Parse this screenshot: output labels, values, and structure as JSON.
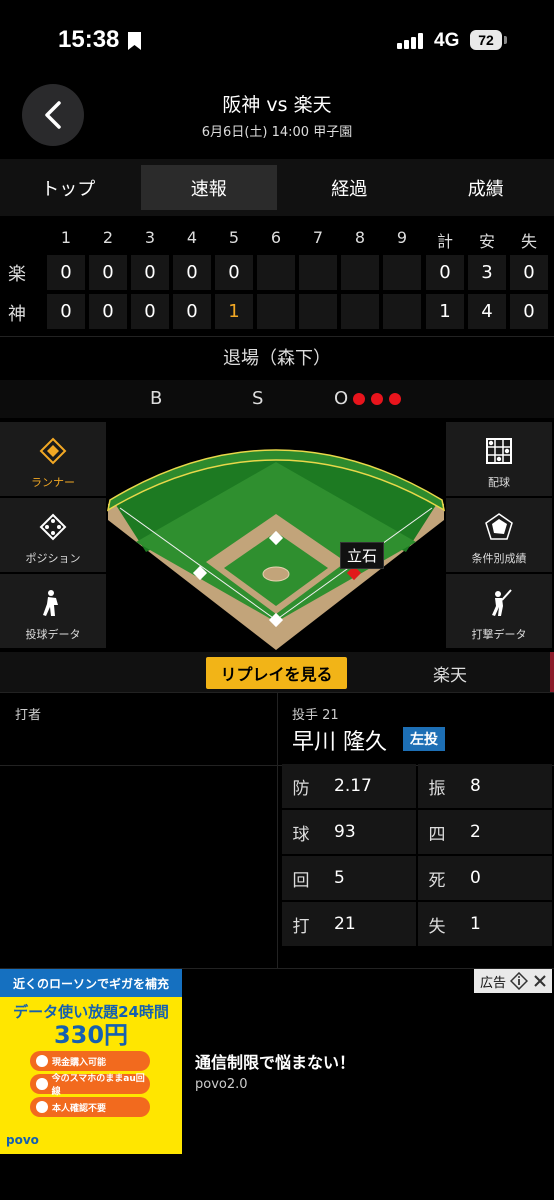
{
  "status_bar": {
    "time": "15:38",
    "network": "4G",
    "battery": "72"
  },
  "header": {
    "title": "阪神 vs 楽天",
    "subtitle": "6月6日(土) 14:00 甲子園",
    "back_icon": "chevron-left-icon"
  },
  "tabs": [
    {
      "label": "トップ",
      "active": false
    },
    {
      "label": "速報",
      "active": true
    },
    {
      "label": "経過",
      "active": false
    },
    {
      "label": "成績",
      "active": false
    }
  ],
  "scoreboard": {
    "headers": [
      "1",
      "2",
      "3",
      "4",
      "5",
      "6",
      "7",
      "8",
      "9",
      "計",
      "安",
      "失"
    ],
    "rows": [
      {
        "team": "楽",
        "innings": [
          "0",
          "0",
          "0",
          "0",
          "0",
          "",
          "",
          "",
          ""
        ],
        "totals": [
          "0",
          "3",
          "0"
        ]
      },
      {
        "team": "神",
        "innings": [
          "0",
          "0",
          "0",
          "0",
          "1",
          "",
          "",
          "",
          ""
        ],
        "totals": [
          "1",
          "4",
          "0"
        ]
      }
    ],
    "highlight_color": "#f2a824"
  },
  "event": "退場（森下）",
  "count": {
    "ball_label": "B",
    "strike_label": "S",
    "out_label": "O",
    "outs": 3,
    "out_color": "#e8141c"
  },
  "left_buttons": [
    {
      "label": "ランナー",
      "icon": "diamond-icon",
      "active": true
    },
    {
      "label": "ポジション",
      "icon": "position-icon",
      "active": false
    },
    {
      "label": "投球データ",
      "icon": "pitcher-icon",
      "active": false
    }
  ],
  "right_buttons": [
    {
      "label": "配球",
      "icon": "grid-icon"
    },
    {
      "label": "条件別成績",
      "icon": "radar-icon"
    },
    {
      "label": "打撃データ",
      "icon": "batter-icon"
    }
  ],
  "field": {
    "runner_label": "立石"
  },
  "replay": {
    "button": "リプレイを見る",
    "team": "楽天"
  },
  "batter": {
    "label": "打者"
  },
  "pitcher": {
    "label": "投手 21",
    "name": "早川 隆久",
    "hand": "左投",
    "stats": [
      {
        "k": "防",
        "v": "2.17",
        "k2": "振",
        "v2": "8"
      },
      {
        "k": "球",
        "v": "93",
        "k2": "四",
        "v2": "2"
      },
      {
        "k": "回",
        "v": "5",
        "k2": "死",
        "v2": "0"
      },
      {
        "k": "打",
        "v": "21",
        "k2": "失",
        "v2": "1"
      }
    ]
  },
  "ad": {
    "image_top": "近くのローソンでギガを補充",
    "image_line1": "データ使い放題24時間",
    "image_price": "330円",
    "image_pills": [
      "現金購入可能",
      "今のスマホのままau回線",
      "本人確認不要"
    ],
    "image_brand": "povo",
    "headline": "通信制限で悩まない！",
    "sponsor": "povo2.0",
    "badge": "広告"
  }
}
